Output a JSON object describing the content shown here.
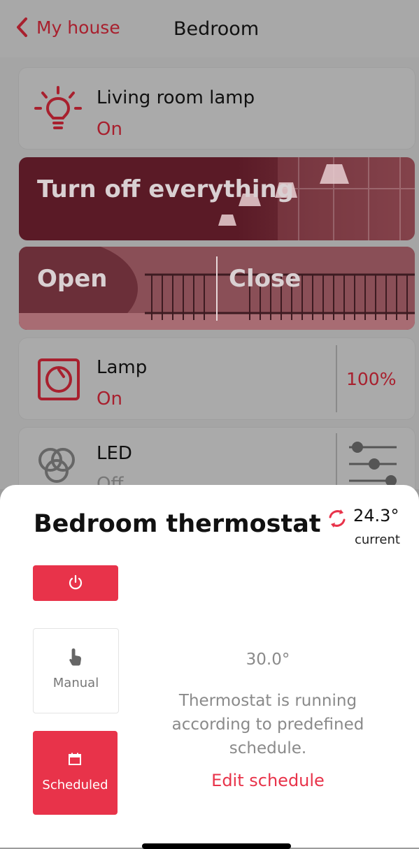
{
  "header": {
    "back_label": "My house",
    "title": "Bedroom"
  },
  "devices": {
    "living_lamp": {
      "name": "Living room lamp",
      "state": "On"
    },
    "lamp": {
      "name": "Lamp",
      "state": "On",
      "level": "100%"
    },
    "led": {
      "name": "LED",
      "state": "Off"
    }
  },
  "scenes": {
    "turn_off": "Turn off everything",
    "gate_open": "Open",
    "gate_close": "Close"
  },
  "thermostat": {
    "title": "Bedroom thermostat",
    "current_temp": "24.3°",
    "current_label": "current",
    "setpoint": "30.0°",
    "status_text": "Thermostat is running according to predefined schedule.",
    "edit_link": "Edit schedule",
    "modes": [
      {
        "label": "Manual",
        "icon": "hand-pointer-icon",
        "active": false
      },
      {
        "label": "Scheduled",
        "icon": "calendar-icon",
        "active": true
      }
    ]
  },
  "colors": {
    "accent": "#e8334a",
    "accent_dark": "#a8202e"
  }
}
